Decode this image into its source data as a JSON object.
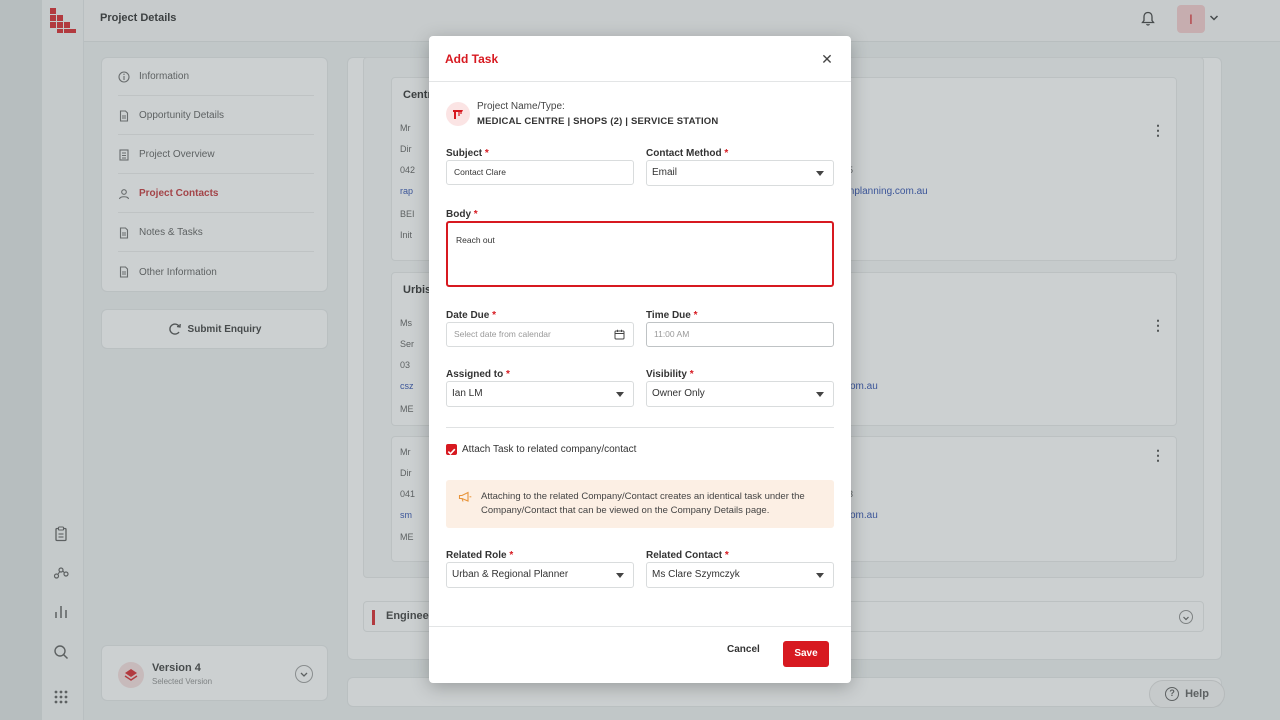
{
  "header": {
    "page_title": "Project Details",
    "avatar_initial": "I"
  },
  "sidebar": {
    "items": [
      {
        "label": "Information",
        "icon": "info-icon"
      },
      {
        "label": "Opportunity Details",
        "icon": "document-icon"
      },
      {
        "label": "Project Overview",
        "icon": "building-icon"
      },
      {
        "label": "Project Contacts",
        "icon": "person-icon",
        "active": true
      },
      {
        "label": "Notes & Tasks",
        "icon": "document-icon"
      },
      {
        "label": "Other Information",
        "icon": "document-icon"
      }
    ],
    "submit_label": "Submit Enquiry",
    "version": {
      "title": "Version 4",
      "subtitle": "Selected Version"
    }
  },
  "background": {
    "card1": {
      "title": "Centr",
      "lines": [
        "Mr",
        "Dir",
        "042",
        "rap",
        "BEI",
        "Init"
      ],
      "link": "mplanning.com.au",
      "partial": "5"
    },
    "card2": {
      "title": "Urbis",
      "lines": [
        "Ms",
        "Ser",
        "03",
        "csz",
        "ME"
      ],
      "link": "om.au"
    },
    "card3": {
      "lines": [
        "Mr",
        "Dir",
        "041",
        "sm",
        "ME"
      ],
      "link": "om.au",
      "partial": "3"
    },
    "engineers_title": "Engineer",
    "help_label": "Help"
  },
  "modal": {
    "title": "Add Task",
    "project_label": "Project Name/Type:",
    "project_value": "MEDICAL CENTRE | SHOPS (2) | SERVICE STATION",
    "subject": {
      "label": "Subject",
      "value": "Contact Clare"
    },
    "contact_method": {
      "label": "Contact Method",
      "value": "Email"
    },
    "body": {
      "label": "Body",
      "value": "Reach out"
    },
    "date_due": {
      "label": "Date Due",
      "placeholder": "Select date from calendar"
    },
    "time_due": {
      "label": "Time Due",
      "placeholder": "11:00 AM"
    },
    "assigned_to": {
      "label": "Assigned to",
      "value": "Ian LM"
    },
    "visibility": {
      "label": "Visibility",
      "value": "Owner Only"
    },
    "attach_label": "Attach Task to related company/contact",
    "attach_checked": true,
    "info_text": "Attaching to the related Company/Contact creates an identical task under the Company/Contact that can be viewed on the Company Details page.",
    "related_role": {
      "label": "Related Role",
      "value": "Urban & Regional Planner"
    },
    "related_contact": {
      "label": "Related Contact",
      "value": "Ms Clare Szymczyk"
    },
    "required_mark": "*",
    "cancel_label": "Cancel",
    "save_label": "Save",
    "accent_color": "#d71920"
  }
}
